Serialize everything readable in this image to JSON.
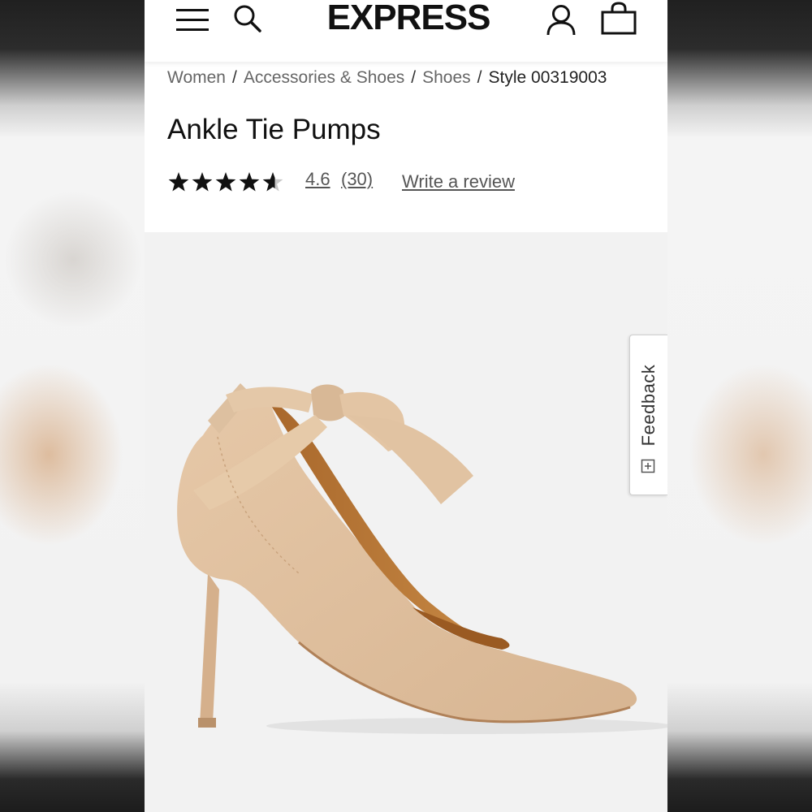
{
  "header": {
    "logo": "EXPRESS",
    "icons": [
      "menu-icon",
      "search-icon",
      "account-icon",
      "shopping-bag-icon"
    ]
  },
  "breadcrumb": {
    "items": [
      "Women",
      "Accessories & Shoes",
      "Shoes"
    ],
    "current": "Style 00319003",
    "separator": "/"
  },
  "product": {
    "title": "Ankle Tie Pumps",
    "rating": 4.6,
    "rating_label": "4.6",
    "review_count_label": "(30)",
    "write_review_label": "Write a review"
  },
  "feedback": {
    "label": "Feedback",
    "icon": "plus-square-icon"
  },
  "colors": {
    "page_background": "#ffffff",
    "image_background": "#f2f2f2",
    "text_primary": "#111111",
    "text_secondary": "#666666",
    "shoe": "#dfbf9f"
  }
}
